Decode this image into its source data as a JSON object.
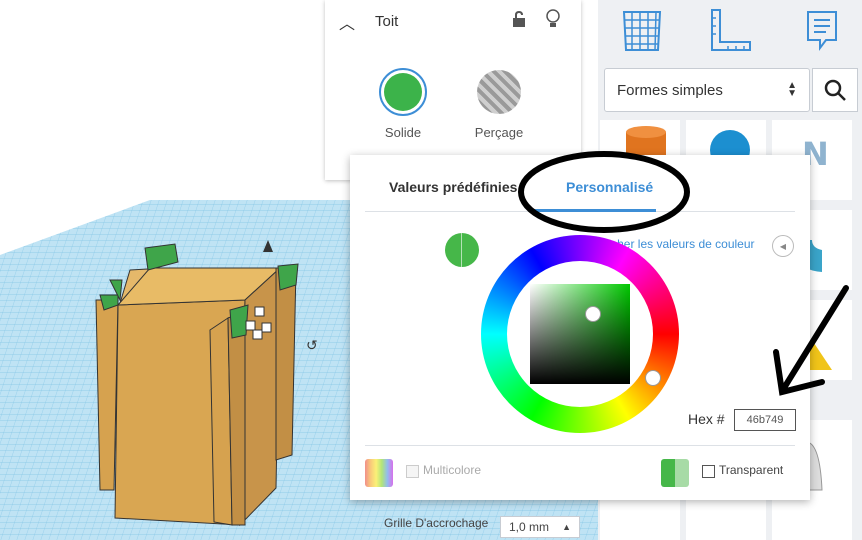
{
  "shape_panel": {
    "title": "Toit",
    "solid_label": "Solide",
    "hole_label": "Perçage",
    "solid_color": "#3cb34a"
  },
  "right_panel": {
    "category": "Formes simples"
  },
  "color_picker": {
    "tab_presets": "Valeurs prédéfinies",
    "tab_custom": "Personnalisé",
    "show_values_link": "Afficher les valeurs de couleur",
    "hex_label": "Hex #",
    "hex_value": "46b749",
    "multicolor_label": "Multicolore",
    "transparent_label": "Transparent",
    "current_color": "#46b749",
    "accent": "#3d8ed6"
  },
  "workplane": {
    "snap_label": "Grille D'accrochage",
    "snap_value": "1,0 mm"
  }
}
